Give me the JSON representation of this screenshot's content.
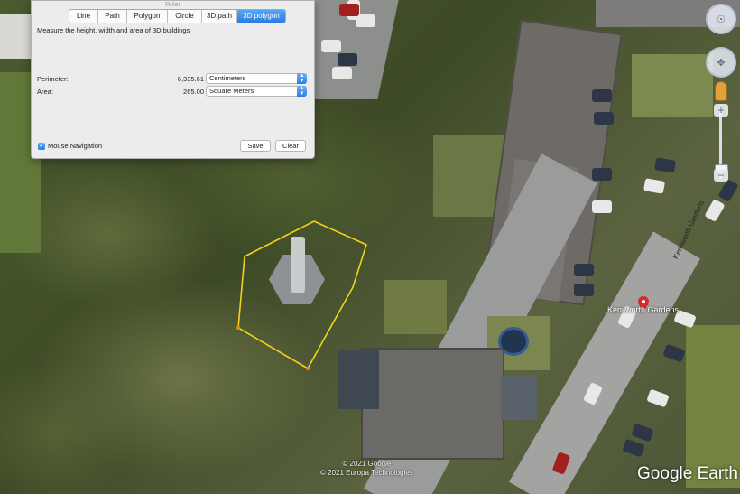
{
  "ruler": {
    "title": "Ruler",
    "tabs": [
      "Line",
      "Path",
      "Polygon",
      "Circle",
      "3D path",
      "3D polygon"
    ],
    "active_tab": "3D polygon",
    "instruction": "Measure the height, width and area of 3D buildings",
    "perimeter": {
      "label": "Perimeter:",
      "value": "6,335.61",
      "unit": "Centimeters"
    },
    "area": {
      "label": "Area:",
      "value": "265.00",
      "unit": "Square Meters"
    },
    "mouse_navigation": {
      "label": "Mouse Navigation",
      "checked": true
    },
    "save_label": "Save",
    "clear_label": "Clear"
  },
  "map": {
    "street_label": "Kenilworth Gardens",
    "street_label_vertical": "Kenilworth Gardens",
    "credit_lines": [
      "© 2021 Google",
      "© 2021 Europa Technologies"
    ],
    "watermark": "Google Earth",
    "polygon_color": "#f2d21b",
    "pin_color": "#d62b2b"
  },
  "navigation": {
    "look_icon": "look-around-icon",
    "move_icon": "move-icon",
    "pegman_icon": "street-view-pegman-icon",
    "zoom_in": "+",
    "zoom_out": "−"
  },
  "colors": {
    "accent": "#2a7de1",
    "dialog_bg": "#ececec"
  }
}
